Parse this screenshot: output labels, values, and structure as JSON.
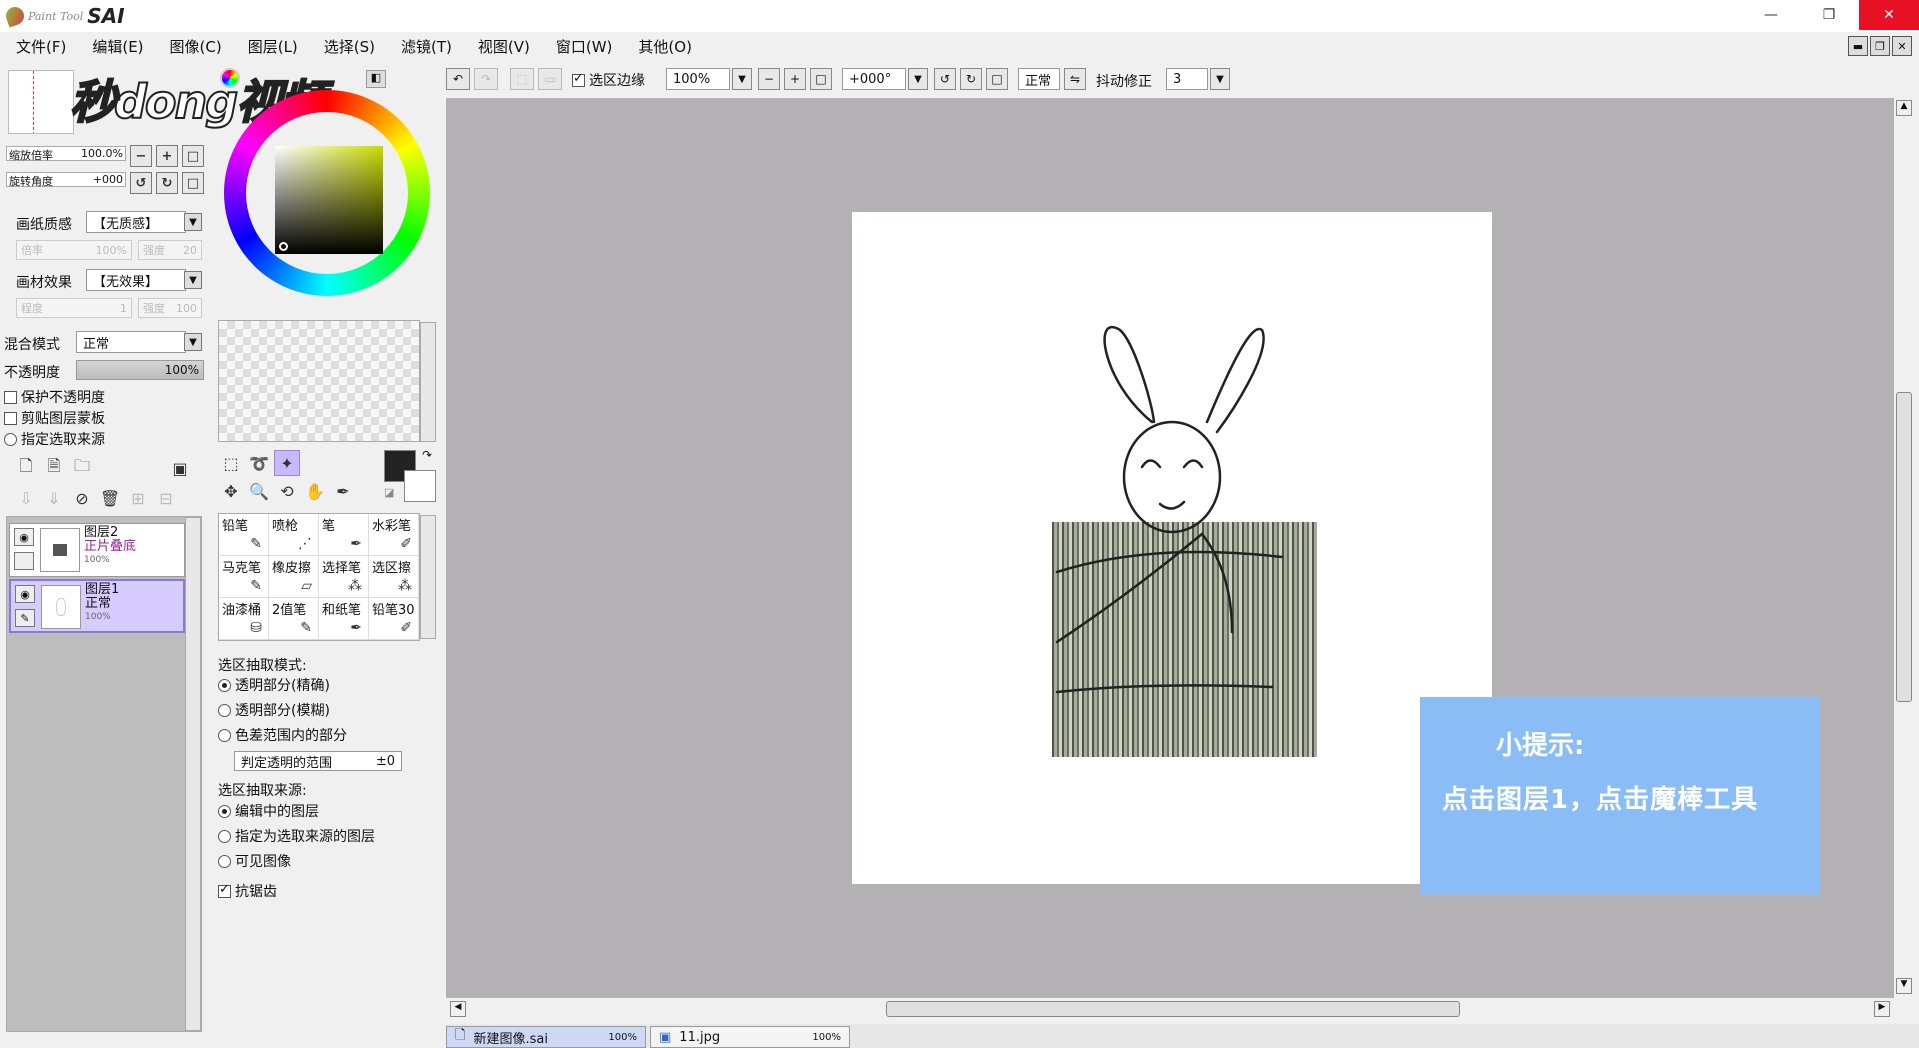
{
  "app": {
    "logo_small": "Paint Tool",
    "logo_big": "SAI"
  },
  "window": {
    "minimize": "—",
    "maximize": "❐",
    "close": "✕"
  },
  "menu": [
    "文件(F)",
    "编辑(E)",
    "图像(C)",
    "图层(L)",
    "选择(S)",
    "滤镜(T)",
    "视图(V)",
    "窗口(W)",
    "其他(O)"
  ],
  "watermark": "秒dong视频",
  "navigator": {
    "zoom_label": "缩放倍率",
    "zoom_value": "100.0%",
    "rotate_label": "旋转角度",
    "rotate_value": "+000"
  },
  "paper": {
    "texture_label": "画纸质感",
    "texture_value": "【无质感】",
    "tex_scale_label": "倍率",
    "tex_scale_value": "100%",
    "tex_strength_label": "强度",
    "tex_strength_value": "20",
    "effect_label": "画材效果",
    "effect_value": "【无效果】",
    "eff_degree_label": "程度",
    "eff_degree_value": "1",
    "eff_strength_label": "强度",
    "eff_strength_value": "100"
  },
  "layer_props": {
    "blend_label": "混合模式",
    "blend_value": "正常",
    "opacity_label": "不透明度",
    "opacity_value": "100%",
    "protect_alpha": "保护不透明度",
    "clip_mask": "剪贴图层蒙板",
    "selection_source": "指定选取来源"
  },
  "layers": [
    {
      "name": "图层2",
      "mode": "正片叠底",
      "opacity": "100%",
      "mode_color": "#a020a0"
    },
    {
      "name": "图层1",
      "mode": "正常",
      "opacity": "100%",
      "mode_color": "#111111"
    }
  ],
  "brushes": [
    {
      "label": "铅笔",
      "icon": "✎"
    },
    {
      "label": "喷枪",
      "icon": "⋰"
    },
    {
      "label": "笔",
      "icon": "✒"
    },
    {
      "label": "水彩笔",
      "icon": "✐"
    },
    {
      "label": "马克笔",
      "icon": "✎"
    },
    {
      "label": "橡皮擦",
      "icon": "▱"
    },
    {
      "label": "选择笔",
      "icon": "⁂"
    },
    {
      "label": "选区擦",
      "icon": "⁂"
    },
    {
      "label": "油漆桶",
      "icon": "⛁"
    },
    {
      "label": "2值笔",
      "icon": "✎"
    },
    {
      "label": "和纸笔",
      "icon": "✒"
    },
    {
      "label": "铅笔30",
      "icon": "✐"
    }
  ],
  "wand_options": {
    "mode_title": "选区抽取模式:",
    "mode_options": [
      "透明部分(精确)",
      "透明部分(模糊)",
      "色差范围内的部分"
    ],
    "range_label": "判定透明的范围",
    "range_value": "±0",
    "source_title": "选区抽取来源:",
    "source_options": [
      "编辑中的图层",
      "指定为选取来源的图层",
      "可见图像"
    ],
    "antialias": "抗锯齿"
  },
  "toolbar": {
    "sel_edge": "选区边缘",
    "zoom": "100%",
    "angle": "+000°",
    "mode": "正常",
    "stabilizer_label": "抖动修正",
    "stabilizer_value": "3"
  },
  "tip": {
    "title": "小提示:",
    "text": "点击图层1，点击魔棒工具"
  },
  "doc_tabs": [
    {
      "name": "新建图像.sai",
      "zoom": "100%"
    },
    {
      "name": "11.jpg",
      "zoom": "100%"
    }
  ]
}
